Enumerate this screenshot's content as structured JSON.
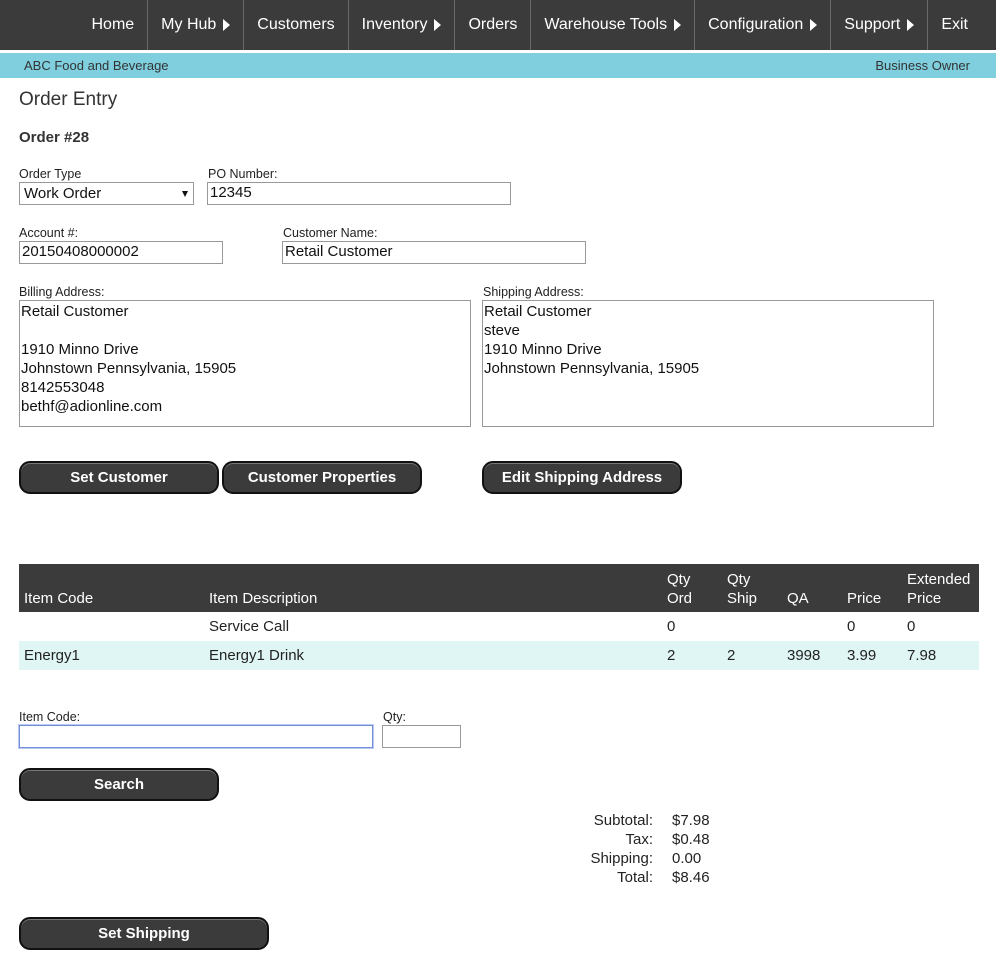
{
  "nav": {
    "items": [
      {
        "label": "Home",
        "caret": false
      },
      {
        "label": "My Hub",
        "caret": true
      },
      {
        "label": "Customers",
        "caret": false
      },
      {
        "label": "Inventory",
        "caret": true
      },
      {
        "label": "Orders",
        "caret": false
      },
      {
        "label": "Warehouse Tools",
        "caret": true
      },
      {
        "label": "Configuration",
        "caret": true
      },
      {
        "label": "Support",
        "caret": true
      },
      {
        "label": "Exit",
        "caret": false
      }
    ]
  },
  "subbar": {
    "company": "ABC Food and Beverage",
    "role": "Business Owner"
  },
  "page": {
    "title": "Order Entry",
    "order_number": "Order #28"
  },
  "form": {
    "order_type": {
      "label": "Order Type",
      "value": "Work Order"
    },
    "po_number": {
      "label": "PO Number:",
      "value": "12345"
    },
    "account": {
      "label": "Account #:",
      "value": "20150408000002"
    },
    "customer_name": {
      "label": "Customer Name:",
      "value": "Retail Customer"
    },
    "billing_address": {
      "label": "Billing Address:",
      "value": "Retail Customer\n\n1910 Minno Drive\nJohnstown Pennsylvania, 15905\n8142553048\nbethf@adionline.com"
    },
    "shipping_address": {
      "label": "Shipping Address:",
      "value": "Retail Customer\nsteve\n1910 Minno Drive\nJohnstown Pennsylvania, 15905"
    }
  },
  "buttons": {
    "set_customer": "Set Customer",
    "customer_properties": "Customer Properties",
    "edit_shipping": "Edit Shipping Address",
    "search": "Search",
    "set_shipping": "Set Shipping"
  },
  "table": {
    "headers": {
      "item_code": "Item Code",
      "item_description": "Item Description",
      "qty_ord_1": "Qty",
      "qty_ord_2": "Ord",
      "qty_ship_1": "Qty",
      "qty_ship_2": "Ship",
      "qa": "QA",
      "price": "Price",
      "ext_1": "Extended",
      "ext_2": "Price"
    },
    "rows": [
      {
        "item_code": "",
        "description": "Service Call",
        "qty_ord": "0",
        "qty_ship": "",
        "qa": "",
        "price": "0",
        "extended": "0"
      },
      {
        "item_code": "Energy1",
        "description": "Energy1 Drink",
        "qty_ord": "2",
        "qty_ship": "2",
        "qa": "3998",
        "price": "3.99",
        "extended": "7.98"
      }
    ]
  },
  "item_entry": {
    "item_code_label": "Item Code:",
    "item_code_value": "",
    "qty_label": "Qty:",
    "qty_value": ""
  },
  "totals": {
    "subtotal_label": "Subtotal:",
    "subtotal": "$7.98",
    "tax_label": "Tax:",
    "tax": "$0.48",
    "shipping_label": "Shipping:",
    "shipping": "0.00",
    "total_label": "Total:",
    "total": "$8.46"
  }
}
